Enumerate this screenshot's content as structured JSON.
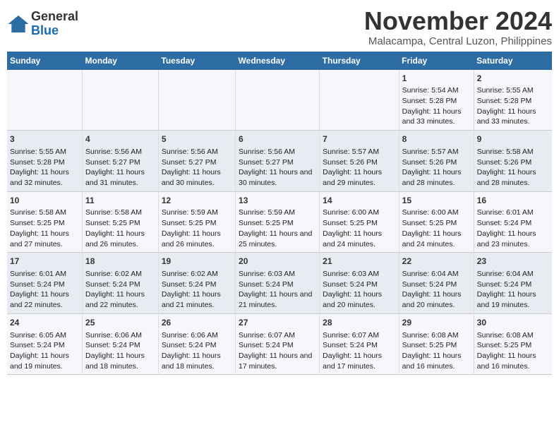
{
  "header": {
    "logo_line1": "General",
    "logo_line2": "Blue",
    "month_year": "November 2024",
    "location": "Malacampa, Central Luzon, Philippines"
  },
  "days_of_week": [
    "Sunday",
    "Monday",
    "Tuesday",
    "Wednesday",
    "Thursday",
    "Friday",
    "Saturday"
  ],
  "weeks": [
    [
      {
        "day": "",
        "info": ""
      },
      {
        "day": "",
        "info": ""
      },
      {
        "day": "",
        "info": ""
      },
      {
        "day": "",
        "info": ""
      },
      {
        "day": "",
        "info": ""
      },
      {
        "day": "1",
        "info": "Sunrise: 5:54 AM\nSunset: 5:28 PM\nDaylight: 11 hours and 33 minutes."
      },
      {
        "day": "2",
        "info": "Sunrise: 5:55 AM\nSunset: 5:28 PM\nDaylight: 11 hours and 33 minutes."
      }
    ],
    [
      {
        "day": "3",
        "info": "Sunrise: 5:55 AM\nSunset: 5:28 PM\nDaylight: 11 hours and 32 minutes."
      },
      {
        "day": "4",
        "info": "Sunrise: 5:56 AM\nSunset: 5:27 PM\nDaylight: 11 hours and 31 minutes."
      },
      {
        "day": "5",
        "info": "Sunrise: 5:56 AM\nSunset: 5:27 PM\nDaylight: 11 hours and 30 minutes."
      },
      {
        "day": "6",
        "info": "Sunrise: 5:56 AM\nSunset: 5:27 PM\nDaylight: 11 hours and 30 minutes."
      },
      {
        "day": "7",
        "info": "Sunrise: 5:57 AM\nSunset: 5:26 PM\nDaylight: 11 hours and 29 minutes."
      },
      {
        "day": "8",
        "info": "Sunrise: 5:57 AM\nSunset: 5:26 PM\nDaylight: 11 hours and 28 minutes."
      },
      {
        "day": "9",
        "info": "Sunrise: 5:58 AM\nSunset: 5:26 PM\nDaylight: 11 hours and 28 minutes."
      }
    ],
    [
      {
        "day": "10",
        "info": "Sunrise: 5:58 AM\nSunset: 5:25 PM\nDaylight: 11 hours and 27 minutes."
      },
      {
        "day": "11",
        "info": "Sunrise: 5:58 AM\nSunset: 5:25 PM\nDaylight: 11 hours and 26 minutes."
      },
      {
        "day": "12",
        "info": "Sunrise: 5:59 AM\nSunset: 5:25 PM\nDaylight: 11 hours and 26 minutes."
      },
      {
        "day": "13",
        "info": "Sunrise: 5:59 AM\nSunset: 5:25 PM\nDaylight: 11 hours and 25 minutes."
      },
      {
        "day": "14",
        "info": "Sunrise: 6:00 AM\nSunset: 5:25 PM\nDaylight: 11 hours and 24 minutes."
      },
      {
        "day": "15",
        "info": "Sunrise: 6:00 AM\nSunset: 5:25 PM\nDaylight: 11 hours and 24 minutes."
      },
      {
        "day": "16",
        "info": "Sunrise: 6:01 AM\nSunset: 5:24 PM\nDaylight: 11 hours and 23 minutes."
      }
    ],
    [
      {
        "day": "17",
        "info": "Sunrise: 6:01 AM\nSunset: 5:24 PM\nDaylight: 11 hours and 22 minutes."
      },
      {
        "day": "18",
        "info": "Sunrise: 6:02 AM\nSunset: 5:24 PM\nDaylight: 11 hours and 22 minutes."
      },
      {
        "day": "19",
        "info": "Sunrise: 6:02 AM\nSunset: 5:24 PM\nDaylight: 11 hours and 21 minutes."
      },
      {
        "day": "20",
        "info": "Sunrise: 6:03 AM\nSunset: 5:24 PM\nDaylight: 11 hours and 21 minutes."
      },
      {
        "day": "21",
        "info": "Sunrise: 6:03 AM\nSunset: 5:24 PM\nDaylight: 11 hours and 20 minutes."
      },
      {
        "day": "22",
        "info": "Sunrise: 6:04 AM\nSunset: 5:24 PM\nDaylight: 11 hours and 20 minutes."
      },
      {
        "day": "23",
        "info": "Sunrise: 6:04 AM\nSunset: 5:24 PM\nDaylight: 11 hours and 19 minutes."
      }
    ],
    [
      {
        "day": "24",
        "info": "Sunrise: 6:05 AM\nSunset: 5:24 PM\nDaylight: 11 hours and 19 minutes."
      },
      {
        "day": "25",
        "info": "Sunrise: 6:06 AM\nSunset: 5:24 PM\nDaylight: 11 hours and 18 minutes."
      },
      {
        "day": "26",
        "info": "Sunrise: 6:06 AM\nSunset: 5:24 PM\nDaylight: 11 hours and 18 minutes."
      },
      {
        "day": "27",
        "info": "Sunrise: 6:07 AM\nSunset: 5:24 PM\nDaylight: 11 hours and 17 minutes."
      },
      {
        "day": "28",
        "info": "Sunrise: 6:07 AM\nSunset: 5:24 PM\nDaylight: 11 hours and 17 minutes."
      },
      {
        "day": "29",
        "info": "Sunrise: 6:08 AM\nSunset: 5:25 PM\nDaylight: 11 hours and 16 minutes."
      },
      {
        "day": "30",
        "info": "Sunrise: 6:08 AM\nSunset: 5:25 PM\nDaylight: 11 hours and 16 minutes."
      }
    ]
  ]
}
